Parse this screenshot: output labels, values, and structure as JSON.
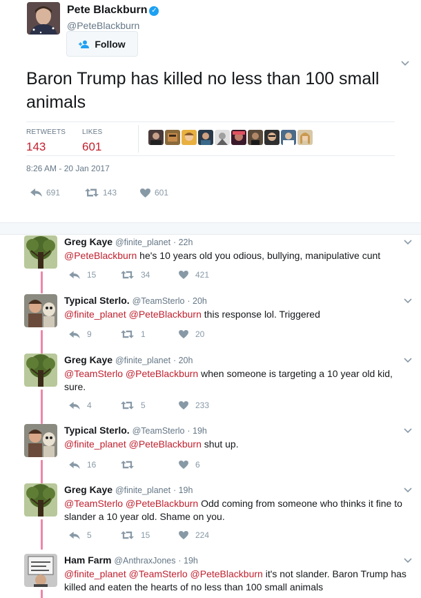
{
  "main_tweet": {
    "author_name": "Pete Blackburn",
    "author_handle": "@PeteBlackburn",
    "follow_label": "Follow",
    "text": "Baron Trump has killed no less than 100 small animals",
    "retweets_label": "RETWEETS",
    "retweets_count": "143",
    "likes_label": "LIKES",
    "likes_count": "601",
    "timestamp": "8:26 AM - 20 Jan 2017",
    "actions": {
      "replies": "691",
      "retweets": "143",
      "likes": "601"
    }
  },
  "replies": [
    {
      "name": "Greg Kaye",
      "handle": "@finite_planet",
      "time": "· 22h",
      "mentions": [
        "@PeteBlackburn"
      ],
      "text": "he's 10 years old you odious, bullying, manipulative cunt",
      "replies": "15",
      "retweets": "34",
      "likes": "421"
    },
    {
      "name": "Typical Sterlo.",
      "handle": "@TeamSterlo",
      "time": "· 20h",
      "mentions": [
        "@finite_planet",
        "@PeteBlackburn"
      ],
      "text": "this response lol. Triggered",
      "replies": "9",
      "retweets": "1",
      "likes": "20"
    },
    {
      "name": "Greg Kaye",
      "handle": "@finite_planet",
      "time": "· 20h",
      "mentions": [
        "@TeamSterlo",
        "@PeteBlackburn"
      ],
      "text": "when someone is targeting a 10 year old kid, sure.",
      "replies": "4",
      "retweets": "5",
      "likes": "233"
    },
    {
      "name": "Typical Sterlo.",
      "handle": "@TeamSterlo",
      "time": "· 19h",
      "mentions": [
        "@finite_planet",
        "@PeteBlackburn"
      ],
      "text": "shut up.",
      "replies": "16",
      "retweets": "",
      "likes": "6"
    },
    {
      "name": "Greg Kaye",
      "handle": "@finite_planet",
      "time": "· 19h",
      "mentions": [
        "@TeamSterlo",
        "@PeteBlackburn"
      ],
      "text": "Odd coming from someone who thinks it fine to slander a 10 year old. Shame on you.",
      "replies": "5",
      "retweets": "15",
      "likes": "224"
    },
    {
      "name": "Ham Farm",
      "handle": "@AnthraxJones",
      "time": "· 19h",
      "mentions": [
        "@finite_planet",
        "@TeamSterlo",
        "@PeteBlackburn"
      ],
      "text": "it's not slander. Baron Trump has killed and eaten the hearts of no less than 100 small animals",
      "replies": "",
      "retweets": "",
      "likes": ""
    }
  ],
  "icons": {
    "reply": "reply-icon",
    "retweet": "retweet-icon",
    "like": "heart-icon",
    "menu": "chevron-down-icon",
    "verified": "verified-badge-icon",
    "follow": "add-user-icon"
  },
  "colors": {
    "accent": "#c0212f",
    "muted": "#657786",
    "action": "#8899a6",
    "thread": "#e0245e",
    "verified": "#1da1f2"
  }
}
